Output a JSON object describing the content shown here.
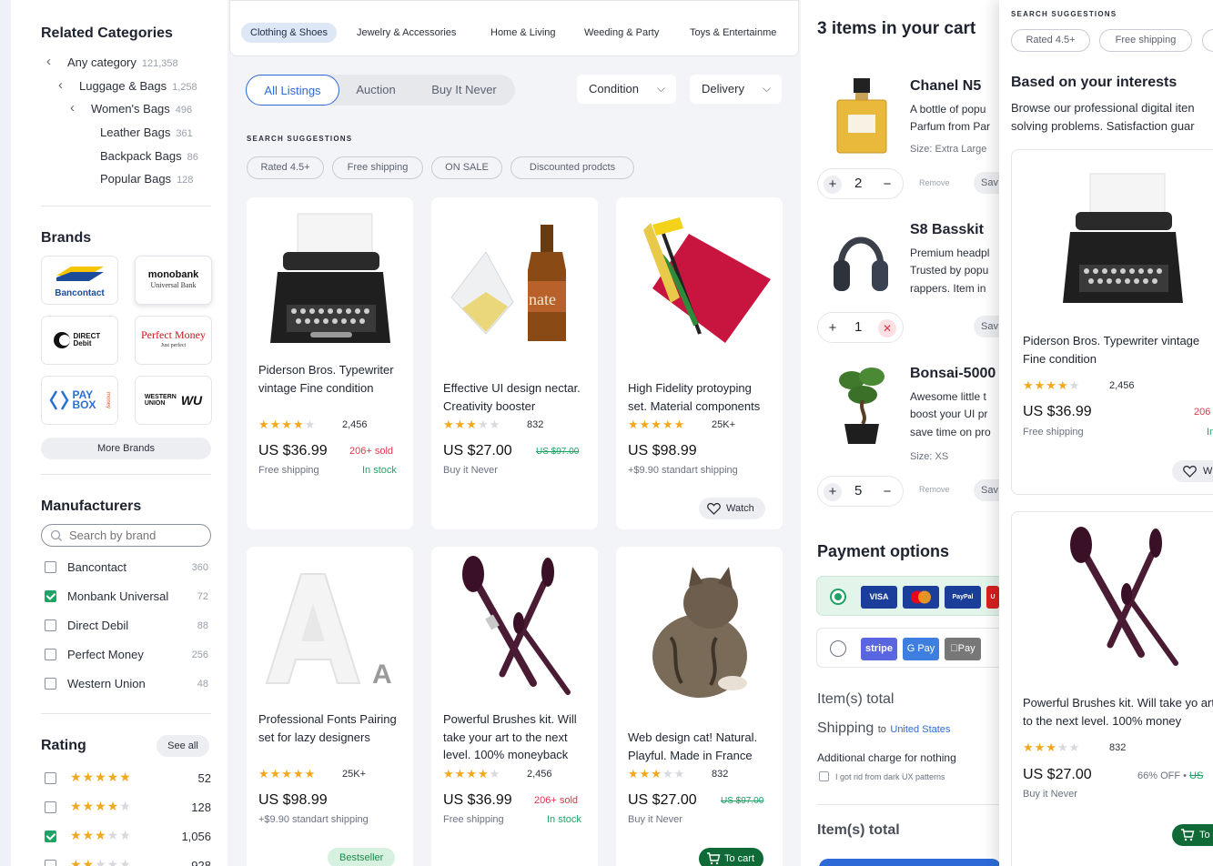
{
  "colors": {
    "accent": "#2d6ad8",
    "success": "#21a366",
    "danger": "#e0364a",
    "star": "#f2a81d",
    "dark_green": "#0f6a37"
  },
  "sidebar": {
    "related_title": "Related Categories",
    "categories": [
      {
        "label": "Any category",
        "count": "121,358"
      },
      {
        "label": "Luggage & Bags",
        "count": "1,258"
      },
      {
        "label": "Women's Bags",
        "count": "496"
      },
      {
        "label": "Leather Bags",
        "count": "361"
      },
      {
        "label": "Backpack Bags",
        "count": "86"
      },
      {
        "label": "Popular Bags",
        "count": "128"
      }
    ],
    "brands_title": "Brands",
    "brands": [
      {
        "name": "Bancontact"
      },
      {
        "name": "monobank",
        "sub": "Universal Bank"
      },
      {
        "name": "DIRECT Debit"
      },
      {
        "name": "Perfect Money",
        "sub": "Just perfect"
      },
      {
        "name": "PAY BOX",
        "sub": "money"
      },
      {
        "name": "WESTERN UNION",
        "sub": "WU"
      }
    ],
    "more_brands": "More Brands",
    "manufacturers_title": "Manufacturers",
    "search_placeholder": "Search by brand",
    "manufacturers": [
      {
        "label": "Bancontact",
        "count": "360",
        "checked": false
      },
      {
        "label": "Monbank Universal",
        "count": "72",
        "checked": true
      },
      {
        "label": "Direct Debil",
        "count": "88",
        "checked": false
      },
      {
        "label": "Perfect Money",
        "count": "256",
        "checked": false
      },
      {
        "label": "Western Union",
        "count": "48",
        "checked": false
      }
    ],
    "rating_title": "Rating",
    "see_all": "See all",
    "ratings": [
      {
        "stars": 5,
        "count": "52",
        "checked": false
      },
      {
        "stars": 4,
        "count": "128",
        "checked": false
      },
      {
        "stars": 3,
        "count": "1,056",
        "checked": true
      },
      {
        "stars": 2,
        "count": "928",
        "checked": false
      }
    ]
  },
  "center": {
    "tabs": [
      "Clothing & Shoes",
      "Jewelry & Accessories",
      "Home & Living",
      "Weeding & Party",
      "Toys & Entertainme"
    ],
    "listing_types": [
      "All Listings",
      "Auction",
      "Buy It Never"
    ],
    "dropdowns": [
      "Condition",
      "Delivery"
    ],
    "suggestions_heading": "SEARCH SUGGESTIONS",
    "suggestions": [
      "Rated 4.5+",
      "Free shipping",
      "ON SALE",
      "Discounted prodcts"
    ],
    "products": [
      {
        "title": "Piderson Bros. Typewriter vintage Fine condition",
        "rating": 4,
        "reviews": "2,456",
        "price": "US $36.99",
        "sold": "206+ sold",
        "shipping": "Free shipping",
        "stock": "In stock"
      },
      {
        "title": "Effective UI design nectar. Creativity booster",
        "rating": 3,
        "reviews": "832",
        "price": "US $27.00",
        "old_price": "US $97.00",
        "shipping": "Buy it Never"
      },
      {
        "title": "High Fidelity protoyping set. Material components",
        "rating": 5,
        "reviews": "25K+",
        "price": "US $98.99",
        "shipping": "+$9.90 standart shipping",
        "watch": "Watch"
      },
      {
        "title": "Professional Fonts Pairing set for lazy designers",
        "rating": 5,
        "reviews": "25K+",
        "price": "US $98.99",
        "shipping": "+$9.90 standart shipping",
        "badge": "Bestseller"
      },
      {
        "title": "Powerful Brushes kit. Will take your art to the next level. 100% moneyback",
        "rating": 4,
        "reviews": "2,456",
        "price": "US $36.99",
        "sold": "206+ sold",
        "shipping": "Free shipping",
        "stock": "In stock"
      },
      {
        "title": "Web design cat! Natural. Playful. Made in France",
        "rating": 3,
        "reviews": "832",
        "price": "US $27.00",
        "old_price": "US $97.00",
        "shipping": "Buy it Never",
        "to_cart": "To cart"
      }
    ]
  },
  "cart": {
    "title": "3 items in your cart",
    "items": [
      {
        "name": "Chanel N5",
        "desc": [
          "A bottle of popu",
          "Parfum from Par"
        ],
        "size": "Size: Extra Large",
        "qty": "2",
        "remove": "Remove",
        "save": "Sav"
      },
      {
        "name": "S8 Basskit",
        "desc": [
          "Premium headpl",
          "Trusted by popu",
          "rappers. Item in"
        ],
        "qty": "1",
        "save": "Sav"
      },
      {
        "name": "Bonsai-5000",
        "desc": [
          "Awesome little t",
          "boost your UI pr",
          "save time on pro"
        ],
        "size": "Size: XS",
        "qty": "5",
        "remove": "Remove",
        "save": "Sav"
      }
    ],
    "payment_title": "Payment options",
    "payment_cards_1": [
      "VISA",
      "MC",
      "PayPal",
      "U"
    ],
    "payment_cards_2": [
      "stripe",
      "G Pay",
      "Pay"
    ],
    "items_total": "Item(s) total",
    "shipping": "Shipping",
    "shipping_to": "to",
    "shipping_dest": "United States",
    "additional": "Additional charge for nothing",
    "dark_ux": "I got rid from dark UX patterns",
    "items_total_2": "Item(s) total"
  },
  "overlay": {
    "suggestions_heading": "SEARCH SUGGESTIONS",
    "chips": [
      "Rated 4.5+",
      "Free shipping"
    ],
    "interests_title": "Based on your interests",
    "interests_desc": [
      "Browse our professional digital iten",
      "solving problems. Satisfaction guar"
    ],
    "products": [
      {
        "title": "Piderson Bros. Typewriter vintage Fine condition",
        "rating": 4,
        "reviews": "2,456",
        "price": "US $36.99",
        "sold": "206",
        "shipping": "Free shipping",
        "stock": "In",
        "watch": "W"
      },
      {
        "title": "Powerful Brushes kit. Will take yo art to the next level. 100% money",
        "rating": 3,
        "reviews": "832",
        "price": "US $27.00",
        "discount": "66% OFF •",
        "old_price": "US",
        "shipping": "Buy it Never",
        "to_cart": "To"
      }
    ]
  }
}
